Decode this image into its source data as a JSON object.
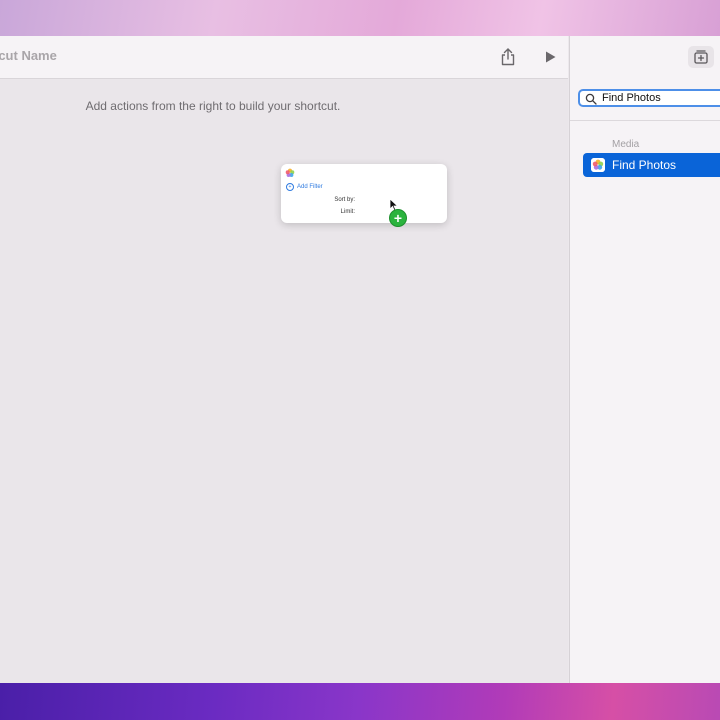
{
  "toolbar": {
    "title": "tcut Name"
  },
  "editor": {
    "hint": "Add actions from the right to build your shortcut.",
    "drag_card": {
      "add_filter_label": "Add Filter",
      "sort_by_label": "Sort by:",
      "limit_label": "Limit:"
    }
  },
  "sidebar": {
    "search": {
      "value": "Find Photos"
    },
    "section_header": "Media",
    "results": [
      {
        "label": "Find Photos",
        "selected": true
      }
    ]
  },
  "icons": {
    "share": "share-icon",
    "run": "play-icon",
    "library": "add-library-icon",
    "search": "magnifier-icon",
    "photos": "photos-app-icon"
  },
  "colors": {
    "accent": "#0a64d8",
    "focus_ring": "#4d8fe8",
    "add_badge": "#2bb33e"
  }
}
